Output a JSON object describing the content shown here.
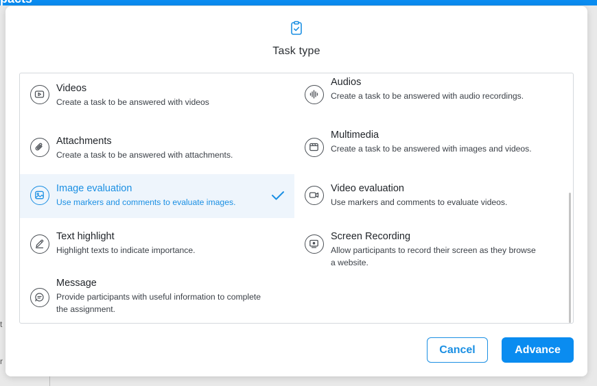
{
  "background": {
    "title_fragment": "pacts",
    "left_fragment_1": "t",
    "left_fragment_2": "r"
  },
  "modal": {
    "header_icon": "clipboard-check-icon",
    "title": "Task type",
    "selected_task": "image-evaluation",
    "tasks": [
      {
        "name": "Videos",
        "desc": "Create a task to be answered with videos",
        "icon": "video-play-icon"
      },
      {
        "name": "Audios",
        "desc": "Create a task to be answered with audio recordings.",
        "icon": "audio-wave-icon"
      },
      {
        "name": "Attachments",
        "desc": "Create a task to be answered with attachments.",
        "icon": "paperclip-icon"
      },
      {
        "name": "Multimedia",
        "desc": "Create a task to be answered with images and videos.",
        "icon": "multimedia-icon"
      },
      {
        "name": "Image evaluation",
        "desc": "Use markers and comments to evaluate images.",
        "icon": "image-edit-icon"
      },
      {
        "name": "Video evaluation",
        "desc": "Use markers and comments to evaluate videos.",
        "icon": "video-camera-icon"
      },
      {
        "name": "Text highlight",
        "desc": "Highlight texts to indicate importance.",
        "icon": "pen-icon"
      },
      {
        "name": "Screen Recording",
        "desc": "Allow participants to record their screen as they browse a website.",
        "icon": "screen-record-icon"
      },
      {
        "name": "Message",
        "desc": "Provide participants with useful information to complete the assignment.",
        "icon": "message-icon"
      }
    ],
    "buttons": {
      "cancel": "Cancel",
      "advance": "Advance"
    },
    "colors": {
      "accent": "#1a8fe3",
      "primary_button": "#0a8cf0",
      "selected_bg": "#eef5fc"
    }
  }
}
